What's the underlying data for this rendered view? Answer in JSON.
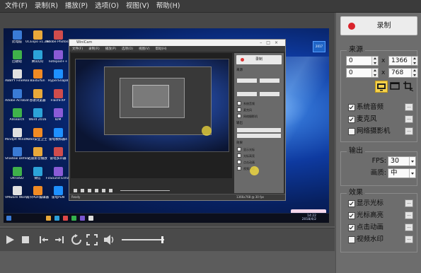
{
  "menu": [
    "文件(F)",
    "录制(R)",
    "播放(P)",
    "选项(O)",
    "视图(V)",
    "帮助(H)"
  ],
  "record": {
    "label": "录制"
  },
  "source": {
    "title": "来源",
    "x": "0",
    "y": "0",
    "width": "1366",
    "height": "768",
    "sep": "x",
    "checks": [
      {
        "label": "系统音频",
        "checked": true
      },
      {
        "label": "麦克风",
        "checked": true
      },
      {
        "label": "网络摄影机",
        "checked": false
      }
    ]
  },
  "output": {
    "title": "输出",
    "fps_label": "FPS:",
    "fps_value": "30",
    "quality_label": "画质:",
    "quality_value": "中"
  },
  "effects": {
    "title": "效果",
    "checks": [
      {
        "label": "显示光标",
        "checked": true
      },
      {
        "label": "光标高亮",
        "checked": true
      },
      {
        "label": "点击动画",
        "checked": true
      },
      {
        "label": "视频水印",
        "checked": false
      }
    ]
  },
  "more_label": "...",
  "preview": {
    "desktop_icons": [
      "此电脑",
      "UCExpo v1.26Lease",
      "Adobe Photosh...",
      "回收站",
      "腾讯QQ",
      "notepad++",
      "ABBYY FineReade...",
      "BaiduYun",
      "HyperSnap8",
      "Adobe Acrobat DC",
      "谷歌浏览器",
      "FlashFXP",
      "Allsearch",
      "Word 2016",
      "IDM",
      "Mindjet MindMan...",
      "360安全卫士",
      "雷电模拟器4",
      "Shadow Defender",
      "迅雷影音播放",
      "雷电多开器",
      "UltraISO",
      "微信",
      "FxSound Enhancer",
      "VMware Workstati...",
      "万兴PDF编辑器",
      "雷电PuN"
    ],
    "nested_title": "WiniCam",
    "nested_menu": [
      "文件(F)",
      "录制(R)",
      "播放(P)",
      "选项(O)",
      "视图(V)",
      "帮助(H)"
    ],
    "nested_record": "录制",
    "nested_source": "来源",
    "nested_checks": [
      "系统音频",
      "麦克风",
      "网络摄影机"
    ],
    "nested_output": "输出",
    "nested_effects": "效果",
    "nested_effect_checks": [
      "显示光标",
      "光标高亮",
      "点击动画",
      "视频水印"
    ],
    "nested_status": [
      "Ready",
      "1366x768 @ 30 fps"
    ],
    "tray_time": "14:22",
    "tray_date": "2018/4/2",
    "badge": "2017"
  },
  "transport_icons": [
    "play-icon",
    "stop-icon",
    "skip-start-icon",
    "skip-end-icon",
    "loop-icon",
    "fullscreen-icon",
    "volume-icon"
  ]
}
